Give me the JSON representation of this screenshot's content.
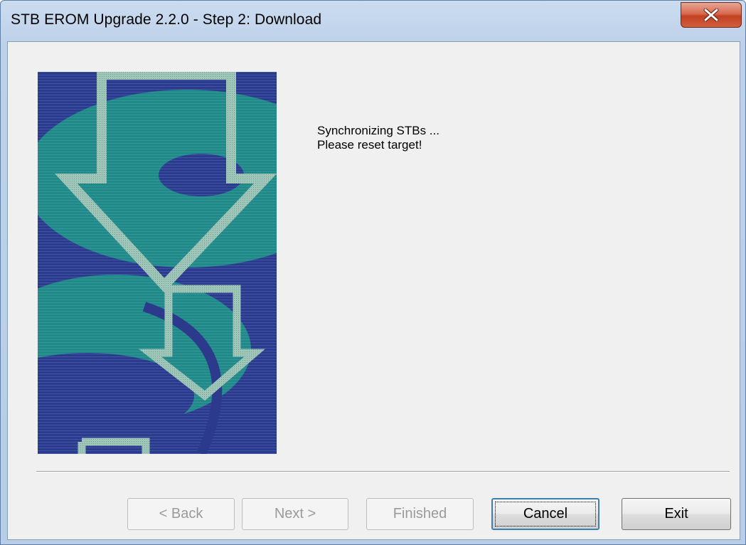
{
  "window": {
    "title": "STB EROM Upgrade 2.2.0  - Step 2: Download",
    "close_icon": "close-icon"
  },
  "wizard": {
    "illustration_icon": "download-arrows-illustration",
    "message_line1": "Synchronizing STBs ...",
    "message_line2": "Please reset target!"
  },
  "buttons": {
    "back": "< Back",
    "next": "Next >",
    "finished": "Finished",
    "cancel": "Cancel",
    "exit": "Exit"
  },
  "colors": {
    "close_button": "#c94a2b",
    "art_background": "#2c3a8c",
    "art_teal": "#23888a",
    "art_arrow": "#9fc6b8"
  }
}
